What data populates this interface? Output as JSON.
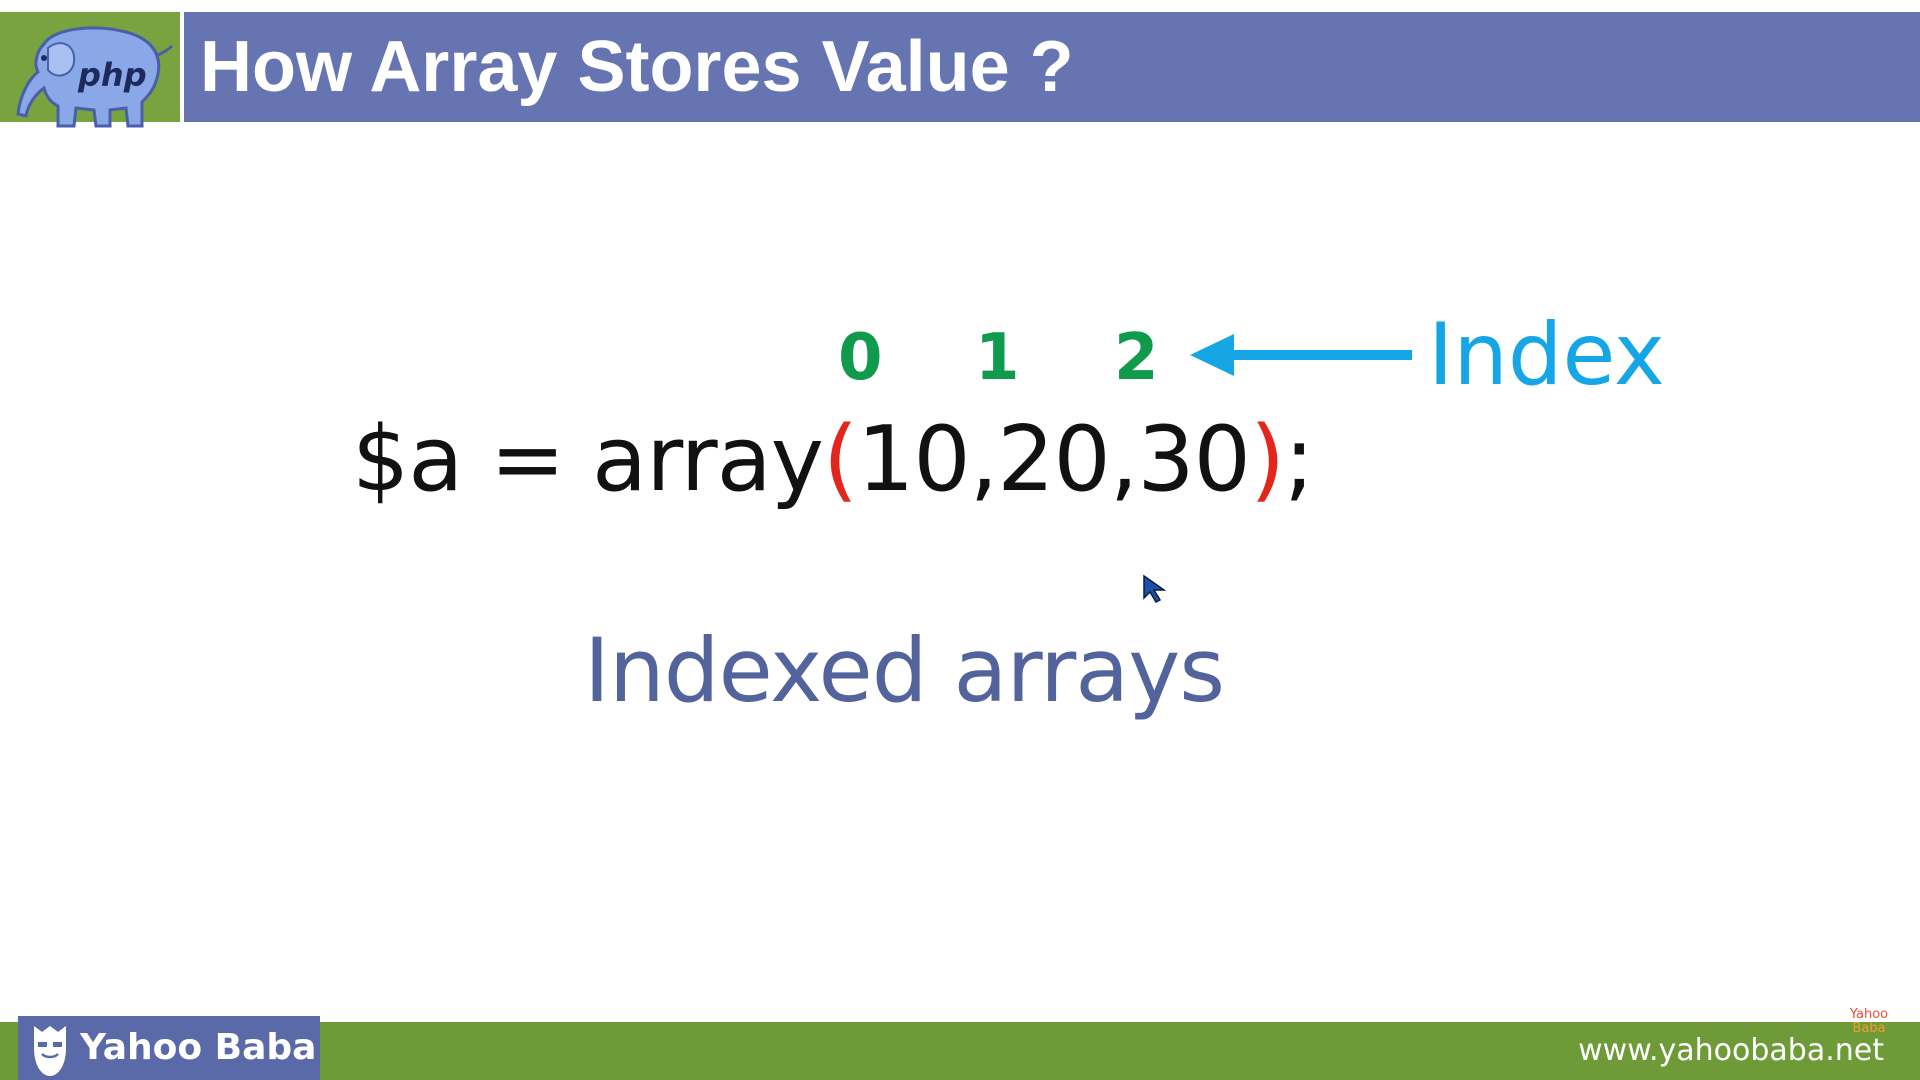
{
  "header": {
    "title": "How Array Stores Value ?",
    "logo_text": "php",
    "colors": {
      "logo_bg": "#78a33e",
      "bar_bg": "#6675b1"
    }
  },
  "slide": {
    "indices": [
      "0",
      "1",
      "2"
    ],
    "index_label": "Index",
    "code": {
      "prefix": "$a = array",
      "open_paren": "(",
      "values": "10,20,30",
      "close_paren": ")",
      "suffix": ";"
    },
    "caption": "Indexed arrays",
    "colors": {
      "index_numbers": "#0f9a4c",
      "index_label": "#16a6e5",
      "parentheses": "#e3261c",
      "caption": "#53639c"
    }
  },
  "footer": {
    "brand": "Yahoo Baba",
    "url": "www.yahoobaba.net",
    "mini_logo_top": "Yahoo",
    "mini_logo_bottom": "Baba",
    "colors": {
      "bar_bg": "#6e9b38",
      "brand_bg": "#5a6aa9"
    }
  }
}
